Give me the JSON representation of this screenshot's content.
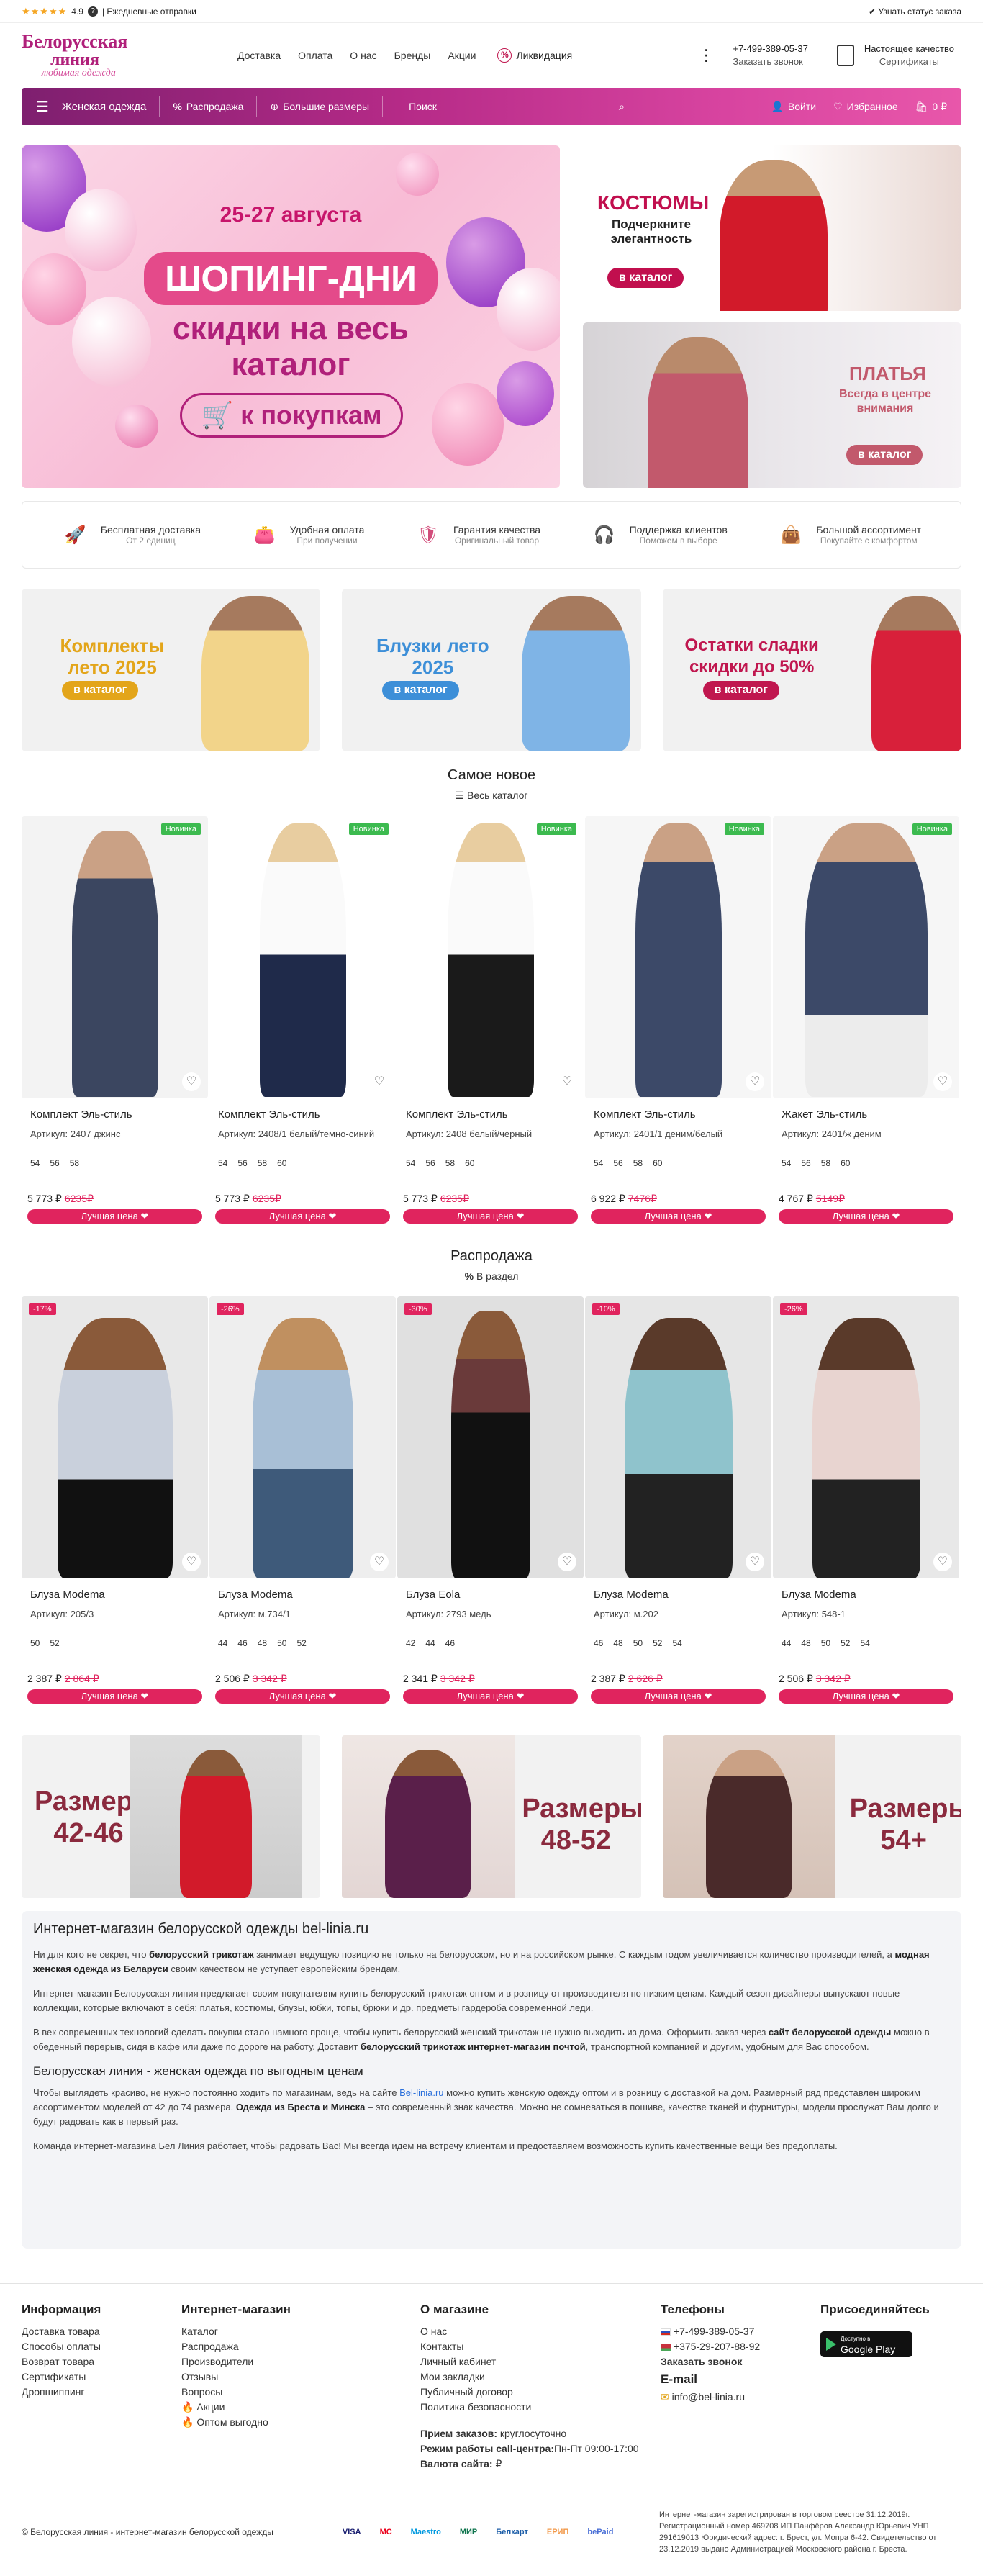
{
  "topbar": {
    "rating": "4.9",
    "shipping": "| Ежедневные отправки",
    "status": "Узнать статус заказа"
  },
  "logo": {
    "line1": "Белорусская",
    "line2": "линия",
    "line3": "любимая одежда"
  },
  "header_nav": [
    "Доставка",
    "Оплата",
    "О нас",
    "Бренды",
    "Акции"
  ],
  "liquidation": "Ликвидация",
  "phone": {
    "number": "+7-499-389-05-37",
    "callback": "Заказать звонок"
  },
  "quality": {
    "line1": "Настоящее качество",
    "line2": "Сертификаты"
  },
  "mainnav": {
    "category": "Женская одежда",
    "sale": "Распродажа",
    "big_sizes": "Большие размеры",
    "search_placeholder": "Поиск",
    "login": "Войти",
    "favorites": "Избранное",
    "cart": "0 ₽"
  },
  "hero": {
    "date": "25-27 августа",
    "shop": "ШОПИНГ-ДНИ",
    "discount": "скидки на весь каталог",
    "cta": "к покупкам",
    "card1_title": "КОСТЮМЫ",
    "card1_sub": "Подчеркните элегантность",
    "card1_btn": "в каталог",
    "card2_title": "ПЛАТЬЯ",
    "card2_sub": "Всегда в центре внимания",
    "card2_btn": "в каталог"
  },
  "benefits": [
    {
      "t1": "Бесплатная доставка",
      "t2": "От 2 единиц"
    },
    {
      "t1": "Удобная оплата",
      "t2": "При получении"
    },
    {
      "t1": "Гарантия качества",
      "t2": "Оригинальный товар"
    },
    {
      "t1": "Поддержка клиентов",
      "t2": "Поможем в выборе"
    },
    {
      "t1": "Большой ассортимент",
      "t2": "Покупайте с комфортом"
    }
  ],
  "promos": [
    {
      "title": "Комплекты лето 2025",
      "btn": "в каталог",
      "color": "#e3a51a"
    },
    {
      "title": "Блузки лето 2025",
      "btn": "в каталог",
      "color": "#3d8fd8"
    },
    {
      "title": "Остатки сладки скидки до 50%",
      "btn": "в каталог",
      "color": "#c0174f"
    }
  ],
  "new_section": {
    "title": "Самое новое",
    "link": "Весь каталог"
  },
  "new_products": [
    {
      "badge": "Новинка",
      "name": "Комплект Эль-стиль",
      "art_label": "Артикул:",
      "art": "2407 джинс",
      "sizes": [
        "54",
        "56",
        "58"
      ],
      "price": "5 773 ₽",
      "old": "6235₽",
      "best": "Лучшая цена"
    },
    {
      "badge": "Новинка",
      "name": "Комплект Эль-стиль",
      "art_label": "Артикул:",
      "art": "2408/1 белый/темно-синий",
      "sizes": [
        "54",
        "56",
        "58",
        "60"
      ],
      "price": "5 773 ₽",
      "old": "6235₽",
      "best": "Лучшая цена"
    },
    {
      "badge": "Новинка",
      "name": "Комплект Эль-стиль",
      "art_label": "Артикул:",
      "art": "2408 белый/черный",
      "sizes": [
        "54",
        "56",
        "58",
        "60"
      ],
      "price": "5 773 ₽",
      "old": "6235₽",
      "best": "Лучшая цена"
    },
    {
      "badge": "Новинка",
      "name": "Комплект Эль-стиль",
      "art_label": "Артикул:",
      "art": "2401/1 деним/белый",
      "sizes": [
        "54",
        "56",
        "58",
        "60"
      ],
      "price": "6 922 ₽",
      "old": "7476₽",
      "best": "Лучшая цена"
    },
    {
      "badge": "Новинка",
      "name": "Жакет Эль-стиль",
      "art_label": "Артикул:",
      "art": "2401/ж деним",
      "sizes": [
        "54",
        "56",
        "58",
        "60"
      ],
      "price": "4 767 ₽",
      "old": "5149₽",
      "best": "Лучшая цена"
    }
  ],
  "sale_section": {
    "title": "Распродажа",
    "link": "В раздел"
  },
  "sale_products": [
    {
      "sale": "-17%",
      "name": "Блуза Modema",
      "art_label": "Артикул:",
      "art": "205/3",
      "sizes": [
        "50",
        "52"
      ],
      "price": "2 387 ₽",
      "old": "2 864 ₽",
      "best": "Лучшая цена"
    },
    {
      "sale": "-26%",
      "name": "Блуза Modema",
      "art_label": "Артикул:",
      "art": "м.734/1",
      "sizes": [
        "44",
        "46",
        "48",
        "50",
        "52"
      ],
      "price": "2 506 ₽",
      "old": "3 342 ₽",
      "best": "Лучшая цена"
    },
    {
      "sale": "-30%",
      "name": "Блуза Eola",
      "art_label": "Артикул:",
      "art": "2793 медь",
      "sizes": [
        "42",
        "44",
        "46"
      ],
      "price": "2 341 ₽",
      "old": "3 342 ₽",
      "best": "Лучшая цена"
    },
    {
      "sale": "-10%",
      "name": "Блуза Modema",
      "art_label": "Артикул:",
      "art": "м.202",
      "sizes": [
        "46",
        "48",
        "50",
        "52",
        "54"
      ],
      "price": "2 387 ₽",
      "old": "2 626 ₽",
      "best": "Лучшая цена"
    },
    {
      "sale": "-26%",
      "name": "Блуза Modema",
      "art_label": "Артикул:",
      "art": "548-1",
      "sizes": [
        "44",
        "48",
        "50",
        "52",
        "54"
      ],
      "price": "2 506 ₽",
      "old": "3 342 ₽",
      "best": "Лучшая цена"
    }
  ],
  "size_banners": [
    {
      "l1": "Размеры",
      "l2": "42-46"
    },
    {
      "l1": "Размеры",
      "l2": "48-52"
    },
    {
      "l1": "Размеры",
      "l2": "54+"
    }
  ],
  "seo": {
    "h1": "Интернет-магазин белорусской одежды bel-linia.ru",
    "p1a": "Ни для кого не секрет, что ",
    "p1b": "белорусский трикотаж",
    "p1c": " занимает ведущую позицию не только на белорусском, но и на российском рынке. С каждым годом увеличивается количество производителей, а ",
    "p1d": "модная женская одежда из Беларуси",
    "p1e": " своим качеством не уступает европейским брендам.",
    "p2": "Интернет-магазин Белорусская линия предлагает своим покупателям купить белорусский трикотаж оптом и в розницу от производителя по низким ценам. Каждый сезон дизайнеры выпускают новые коллекции, которые включают в себя: платья, костюмы, блузы, юбки, топы, брюки и др. предметы гардероба современной леди.",
    "p3a": "В век современных технологий сделать покупки стало намного проще, чтобы купить белорусский женский трикотаж не нужно выходить из дома. Оформить заказ через ",
    "p3b": "сайт белорусской одежды",
    "p3c": " можно в обеденный перерыв, сидя в кафе или даже по дороге на работу. Доставит ",
    "p3d": "белорусский трикотаж интернет-магазин почтой",
    "p3e": ", транспортной компанией и другим, удобным для Вас способом.",
    "h2": "Белорусская линия - женская одежда по выгодным ценам",
    "p4a": "Чтобы выглядеть красиво, не нужно постоянно ходить по магазинам, ведь на сайте ",
    "p4b": "Bel-linia.ru",
    "p4c": " можно купить женскую одежду оптом и в розницу с доставкой на дом. Размерный ряд представлен широким ассортиментом моделей от 42 до 74 размера. ",
    "p4d": "Одежда из Бреста и Минска",
    "p4e": " – это современный знак качества. Можно не сомневаться в пошиве, качестве тканей и фурнитуры, модели прослужат Вам долго и будут радовать как в первый раз.",
    "p5": "Команда интернет-магазина Бел Линия работает, чтобы радовать Вас! Мы всегда идем на встречу клиентам и предоставляем возможность купить качественные вещи без предоплаты."
  },
  "footer": {
    "info_title": "Информация",
    "info": [
      "Доставка товара",
      "Способы оплаты",
      "Возврат товара",
      "Сертификаты",
      "Дропшиппинг"
    ],
    "shop_title": "Интернет-магазин",
    "shop": [
      "Каталог",
      "Распродажа",
      "Производители",
      "Отзывы",
      "Вопросы"
    ],
    "shop_fire": [
      "Акции",
      "Оптом выгодно"
    ],
    "about_title": "О магазине",
    "about": [
      "О нас",
      "Контакты",
      "Личный кабинет",
      "Мои закладки",
      "Публичный договор",
      "Политика безопасности"
    ],
    "orders_label": "Прием заказов:",
    "orders_val": " круглосуточно",
    "callcenter_label": "Режим работы call-центра:",
    "callcenter_val": "Пн-Пт 09:00-17:00",
    "currency_label": "Валюта сайта:",
    "currency_val": " ₽",
    "phones_title": "Телефоны",
    "phone_ru": "+7-499-389-05-37",
    "phone_by": "+375-29-207-88-92",
    "callback": "Заказать звонок",
    "email_title": "E-mail",
    "email": "info@bel-linia.ru",
    "join_title": "Присоединяйтесь",
    "gp_small": "Доступно в",
    "gp_big": "Google Play",
    "copyright": "© Белорусская линия - интернет-магазин белорусской одежды",
    "payments": [
      "VISA",
      "MC",
      "Maestro",
      "МИР",
      "Белкарт",
      "ЕРИП",
      "bePaid"
    ],
    "legal": "Интернет-магазин зарегистрирован в торговом реестре 31.12.2019г. Регистрационный номер 469708 ИП Панфёров Александр Юрьевич УНП 291619013 Юридический адрес: г. Брест, ул. Мопра 6-42. Свидетельство от 23.12.2019 выдано Администрацией Московского района г. Бреста."
  },
  "colors": {
    "accent": "#c0174f",
    "brand": "#b0207a",
    "new_badge": "#3cba4f"
  }
}
